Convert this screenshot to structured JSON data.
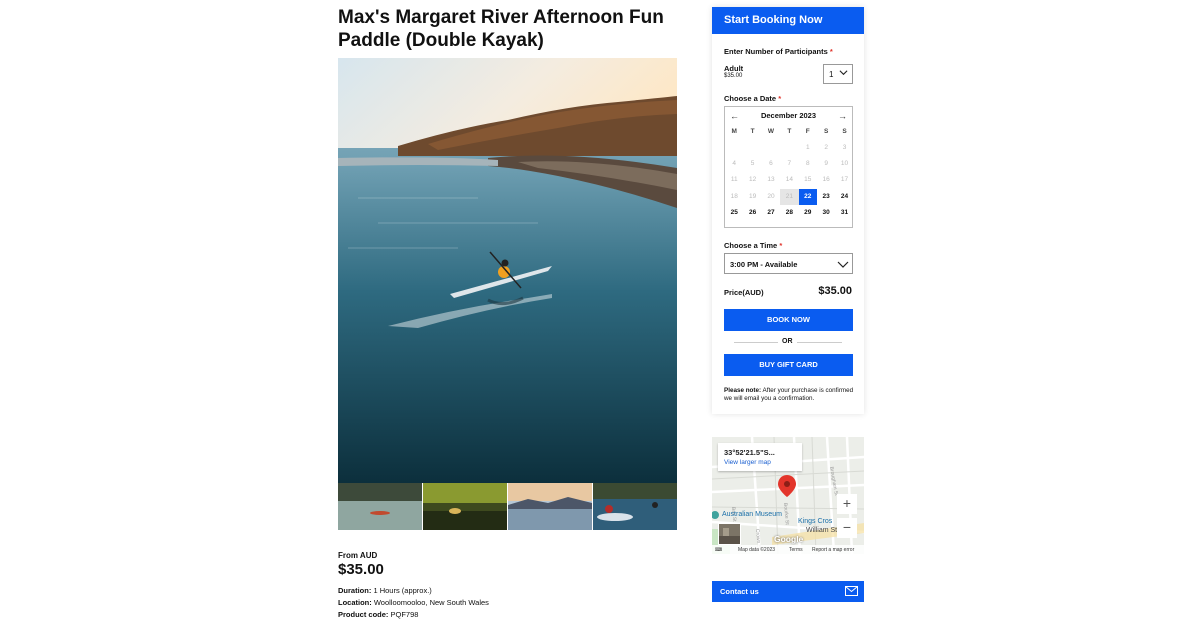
{
  "product": {
    "title": "Max's Margaret River Afternoon Fun Paddle (Double Kayak)",
    "from_label": "From AUD",
    "price": "$35.00",
    "details": [
      {
        "label": "Duration:",
        "value": "1 Hours (approx.)"
      },
      {
        "label": "Location:",
        "value": "Woolloomooloo, New South Wales"
      },
      {
        "label": "Product code:",
        "value": "PQF798"
      }
    ]
  },
  "booking": {
    "header": "Start Booking Now",
    "participants_label": "Enter Number of Participants",
    "participant_type": "Adult",
    "participant_price": "$35.00",
    "quantity": "1",
    "date_label": "Choose a Date",
    "calendar": {
      "month": "December 2023",
      "weekdays": [
        "M",
        "T",
        "W",
        "T",
        "F",
        "S",
        "S"
      ],
      "leading_blanks": 4,
      "days": [
        "1",
        "2",
        "3",
        "4",
        "5",
        "6",
        "7",
        "8",
        "9",
        "10",
        "11",
        "12",
        "13",
        "14",
        "15",
        "16",
        "17",
        "18",
        "19",
        "20",
        "21",
        "22",
        "23",
        "24",
        "25",
        "26",
        "27",
        "28",
        "29",
        "30",
        "31"
      ],
      "today": "21",
      "selected": "22",
      "available_from": 22,
      "also_available": [
        "27"
      ]
    },
    "time_label": "Choose a Time",
    "time_value": "3:00 PM - Available",
    "price_label": "Price(AUD)",
    "price_value": "$35.00",
    "book_now": "BOOK NOW",
    "or": "OR",
    "gift_card": "BUY GIFT CARD",
    "note_bold": "Please note:",
    "note_text": "After your purchase is confirmed we will email you a confirmation.",
    "required_mark": "*"
  },
  "map": {
    "coords": "33°52'21.5\"S...",
    "view_larger": "View larger map",
    "labels": {
      "museum": "Australian Museum",
      "kings": "Kings Cros",
      "william": "William St",
      "google": "Google"
    },
    "zoom_in": "+",
    "zoom_out": "−",
    "footer_data": "Map data ©2023",
    "footer_terms": "Terms",
    "footer_report": "Report a map error",
    "pin_color": "#e3352b"
  },
  "contact": {
    "label": "Contact us"
  },
  "colors": {
    "accent": "#0a5cf0"
  }
}
